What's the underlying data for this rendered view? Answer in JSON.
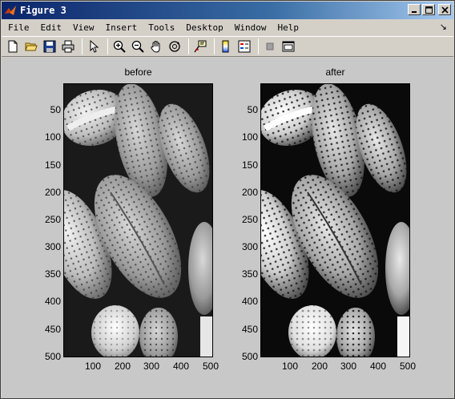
{
  "window": {
    "title": "Figure 3",
    "min_label": "_",
    "max_label": "□",
    "close_label": "×"
  },
  "menu": {
    "items": [
      "File",
      "Edit",
      "View",
      "Insert",
      "Tools",
      "Desktop",
      "Window",
      "Help"
    ],
    "dock_symbol": "↘"
  },
  "toolbar": {
    "icons": [
      "new-figure-icon",
      "open-file-icon",
      "save-icon",
      "print-icon",
      "pointer-icon",
      "zoom-in-icon",
      "zoom-out-icon",
      "pan-hand-icon",
      "rotate-3d-icon",
      "data-cursor-icon",
      "colorbar-icon",
      "legend-icon",
      "hide-plot-tools-icon",
      "show-plot-tools-icon"
    ]
  },
  "plots": [
    {
      "title": "before",
      "yticks": [
        "50",
        "100",
        "150",
        "200",
        "250",
        "300",
        "350",
        "400",
        "450",
        "500"
      ],
      "xticks": [
        "100",
        "200",
        "300",
        "400",
        "500"
      ]
    },
    {
      "title": "after",
      "yticks": [
        "50",
        "100",
        "150",
        "200",
        "250",
        "300",
        "350",
        "400",
        "450",
        "500"
      ],
      "xticks": [
        "100",
        "200",
        "300",
        "400",
        "500"
      ]
    }
  ],
  "colors": {
    "titlebar_start": "#0a246a",
    "titlebar_end": "#a6caf0",
    "figure_bg": "#c8c8c8"
  }
}
